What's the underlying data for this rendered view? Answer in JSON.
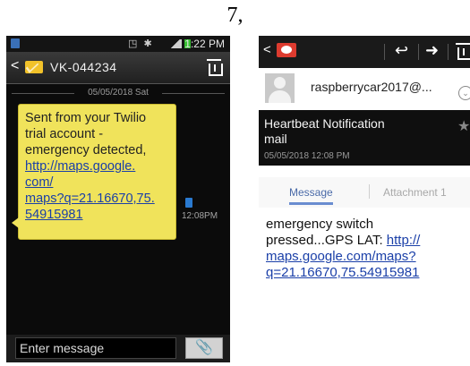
{
  "figure_label": "7,",
  "left_phone": {
    "status_time": "1:22 PM",
    "contact_name": "VK-044234",
    "date_separator": "05/05/2018 Sat",
    "message_lines": [
      "Sent from your Twilio",
      "trial account -",
      "emergency detected,"
    ],
    "link_lines": [
      "http://maps.google.",
      "com/",
      "maps?q=21.16670,75.",
      "54915981"
    ],
    "message_time": "12:08PM",
    "compose_placeholder": "Enter message",
    "icons": [
      "back-icon",
      "envelope-icon",
      "trash-icon",
      "sim-icon",
      "paperclip-icon"
    ]
  },
  "right_phone": {
    "sender_address": "raspberrycar2017@...",
    "subject_lines": [
      "Heartbeat Notification",
      "mail"
    ],
    "date": "05/05/2018 12:08 PM",
    "tabs": [
      "Message",
      "Attachment 1"
    ],
    "body_lines": [
      "emergency switch",
      "pressed...GPS LAT:"
    ],
    "body_link_first": "http://",
    "body_link_lines": [
      "maps.google.com/maps?",
      "q=21.16670,75.54915981"
    ],
    "icons": [
      "back-icon",
      "gmail-icon",
      "reply-icon",
      "forward-icon",
      "trash-icon",
      "avatar-icon",
      "chevron-icon",
      "star-icon"
    ]
  }
}
